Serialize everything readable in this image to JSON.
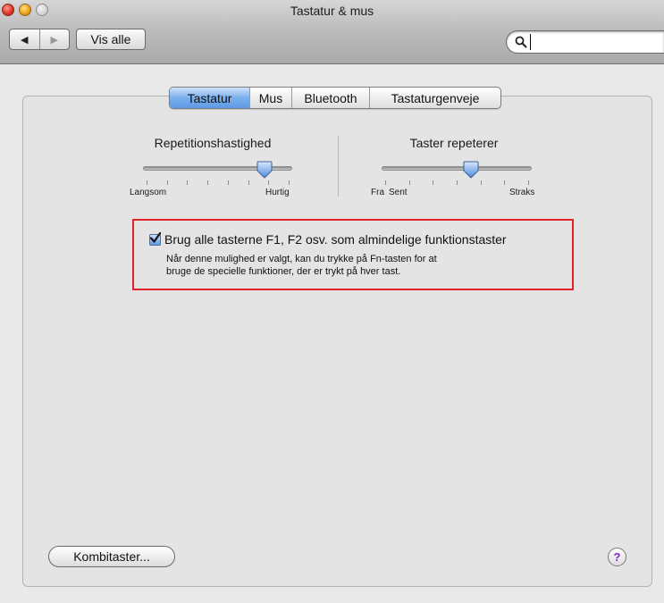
{
  "window": {
    "title": "Tastatur & mus"
  },
  "toolbar": {
    "back_glyph": "◀",
    "forward_glyph": "▶",
    "show_all_label": "Vis alle",
    "search_placeholder": "",
    "search_value": ""
  },
  "tabs": [
    {
      "label": "Tastatur",
      "active": true
    },
    {
      "label": "Mus",
      "active": false
    },
    {
      "label": "Bluetooth",
      "active": false
    },
    {
      "label": "Tastaturgenveje",
      "active": false
    }
  ],
  "sliders": {
    "repeat_rate": {
      "title": "Repetitionshastighed",
      "min_label": "Langsom",
      "max_label": "Hurtig",
      "value_fraction": 0.83,
      "ticks": 8
    },
    "delay_until_repeat": {
      "title": "Taster repeterer",
      "labels": [
        "Fra",
        "Sent",
        "Straks"
      ],
      "value_fraction": 0.6,
      "ticks": 7
    }
  },
  "fn_keys": {
    "checked": true,
    "label": "Brug alle tasterne F1, F2 osv. som almindelige funktionstaster",
    "description_line1": "Når denne mulighed er valgt, kan du trykke på Fn-tasten for at",
    "description_line2": "bruge de specielle funktioner, der er trykt på hver tast."
  },
  "footer": {
    "modifier_keys_label": "Kombitaster...",
    "help_glyph": "?"
  },
  "colors": {
    "highlight_border": "#e0232b",
    "accent_blue": "#5e9ae6",
    "help_glyph": "#7a2fc8"
  }
}
